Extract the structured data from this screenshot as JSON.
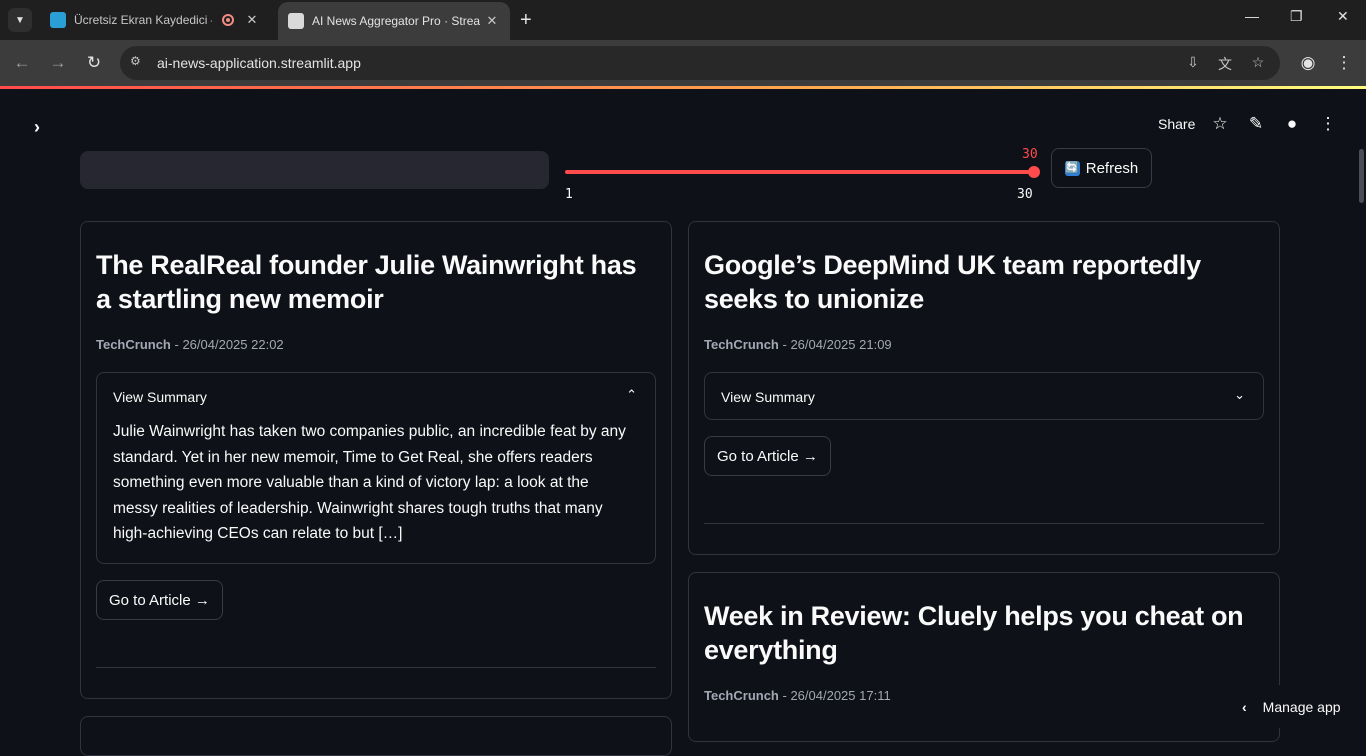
{
  "browser": {
    "tabs": [
      {
        "title": "Ücretsiz Ekran Kaydedici – V",
        "active": false
      },
      {
        "title": "AI News Aggregator Pro · Strea",
        "active": true
      }
    ],
    "url": "ai-news-application.streamlit.app"
  },
  "app_header": {
    "share_label": "Share"
  },
  "controls": {
    "search_value": "",
    "slider": {
      "value": 30,
      "min": 1,
      "max": 30
    },
    "refresh_label": "Refresh"
  },
  "articles": [
    {
      "title": "The RealReal founder Julie Wainwright has a startling new memoir",
      "source": "TechCrunch",
      "date": "- 26/04/2025 22:02",
      "summary_label": "View Summary",
      "summary": "Julie Wainwright has taken two companies public, an incredible feat by any standard. Yet in her new memoir, Time to Get Real, she offers readers something even more valuable than a kind of victory lap: a look at the messy realities of leadership. Wainwright shares tough truths that many high-achieving CEOs can relate to but […]",
      "expanded": true,
      "link_label": "Go to Article →"
    },
    {
      "title": "Google’s DeepMind UK team reportedly seeks to unionize",
      "source": "TechCrunch",
      "date": "- 26/04/2025 21:09",
      "summary_label": "View Summary",
      "expanded": false,
      "link_label": "Go to Article →"
    },
    {
      "title": "Week in Review: Cluely helps you cheat on everything",
      "source": "TechCrunch",
      "date": "- 26/04/2025 17:11"
    }
  ],
  "footer": {
    "manage_label": "Manage app"
  }
}
